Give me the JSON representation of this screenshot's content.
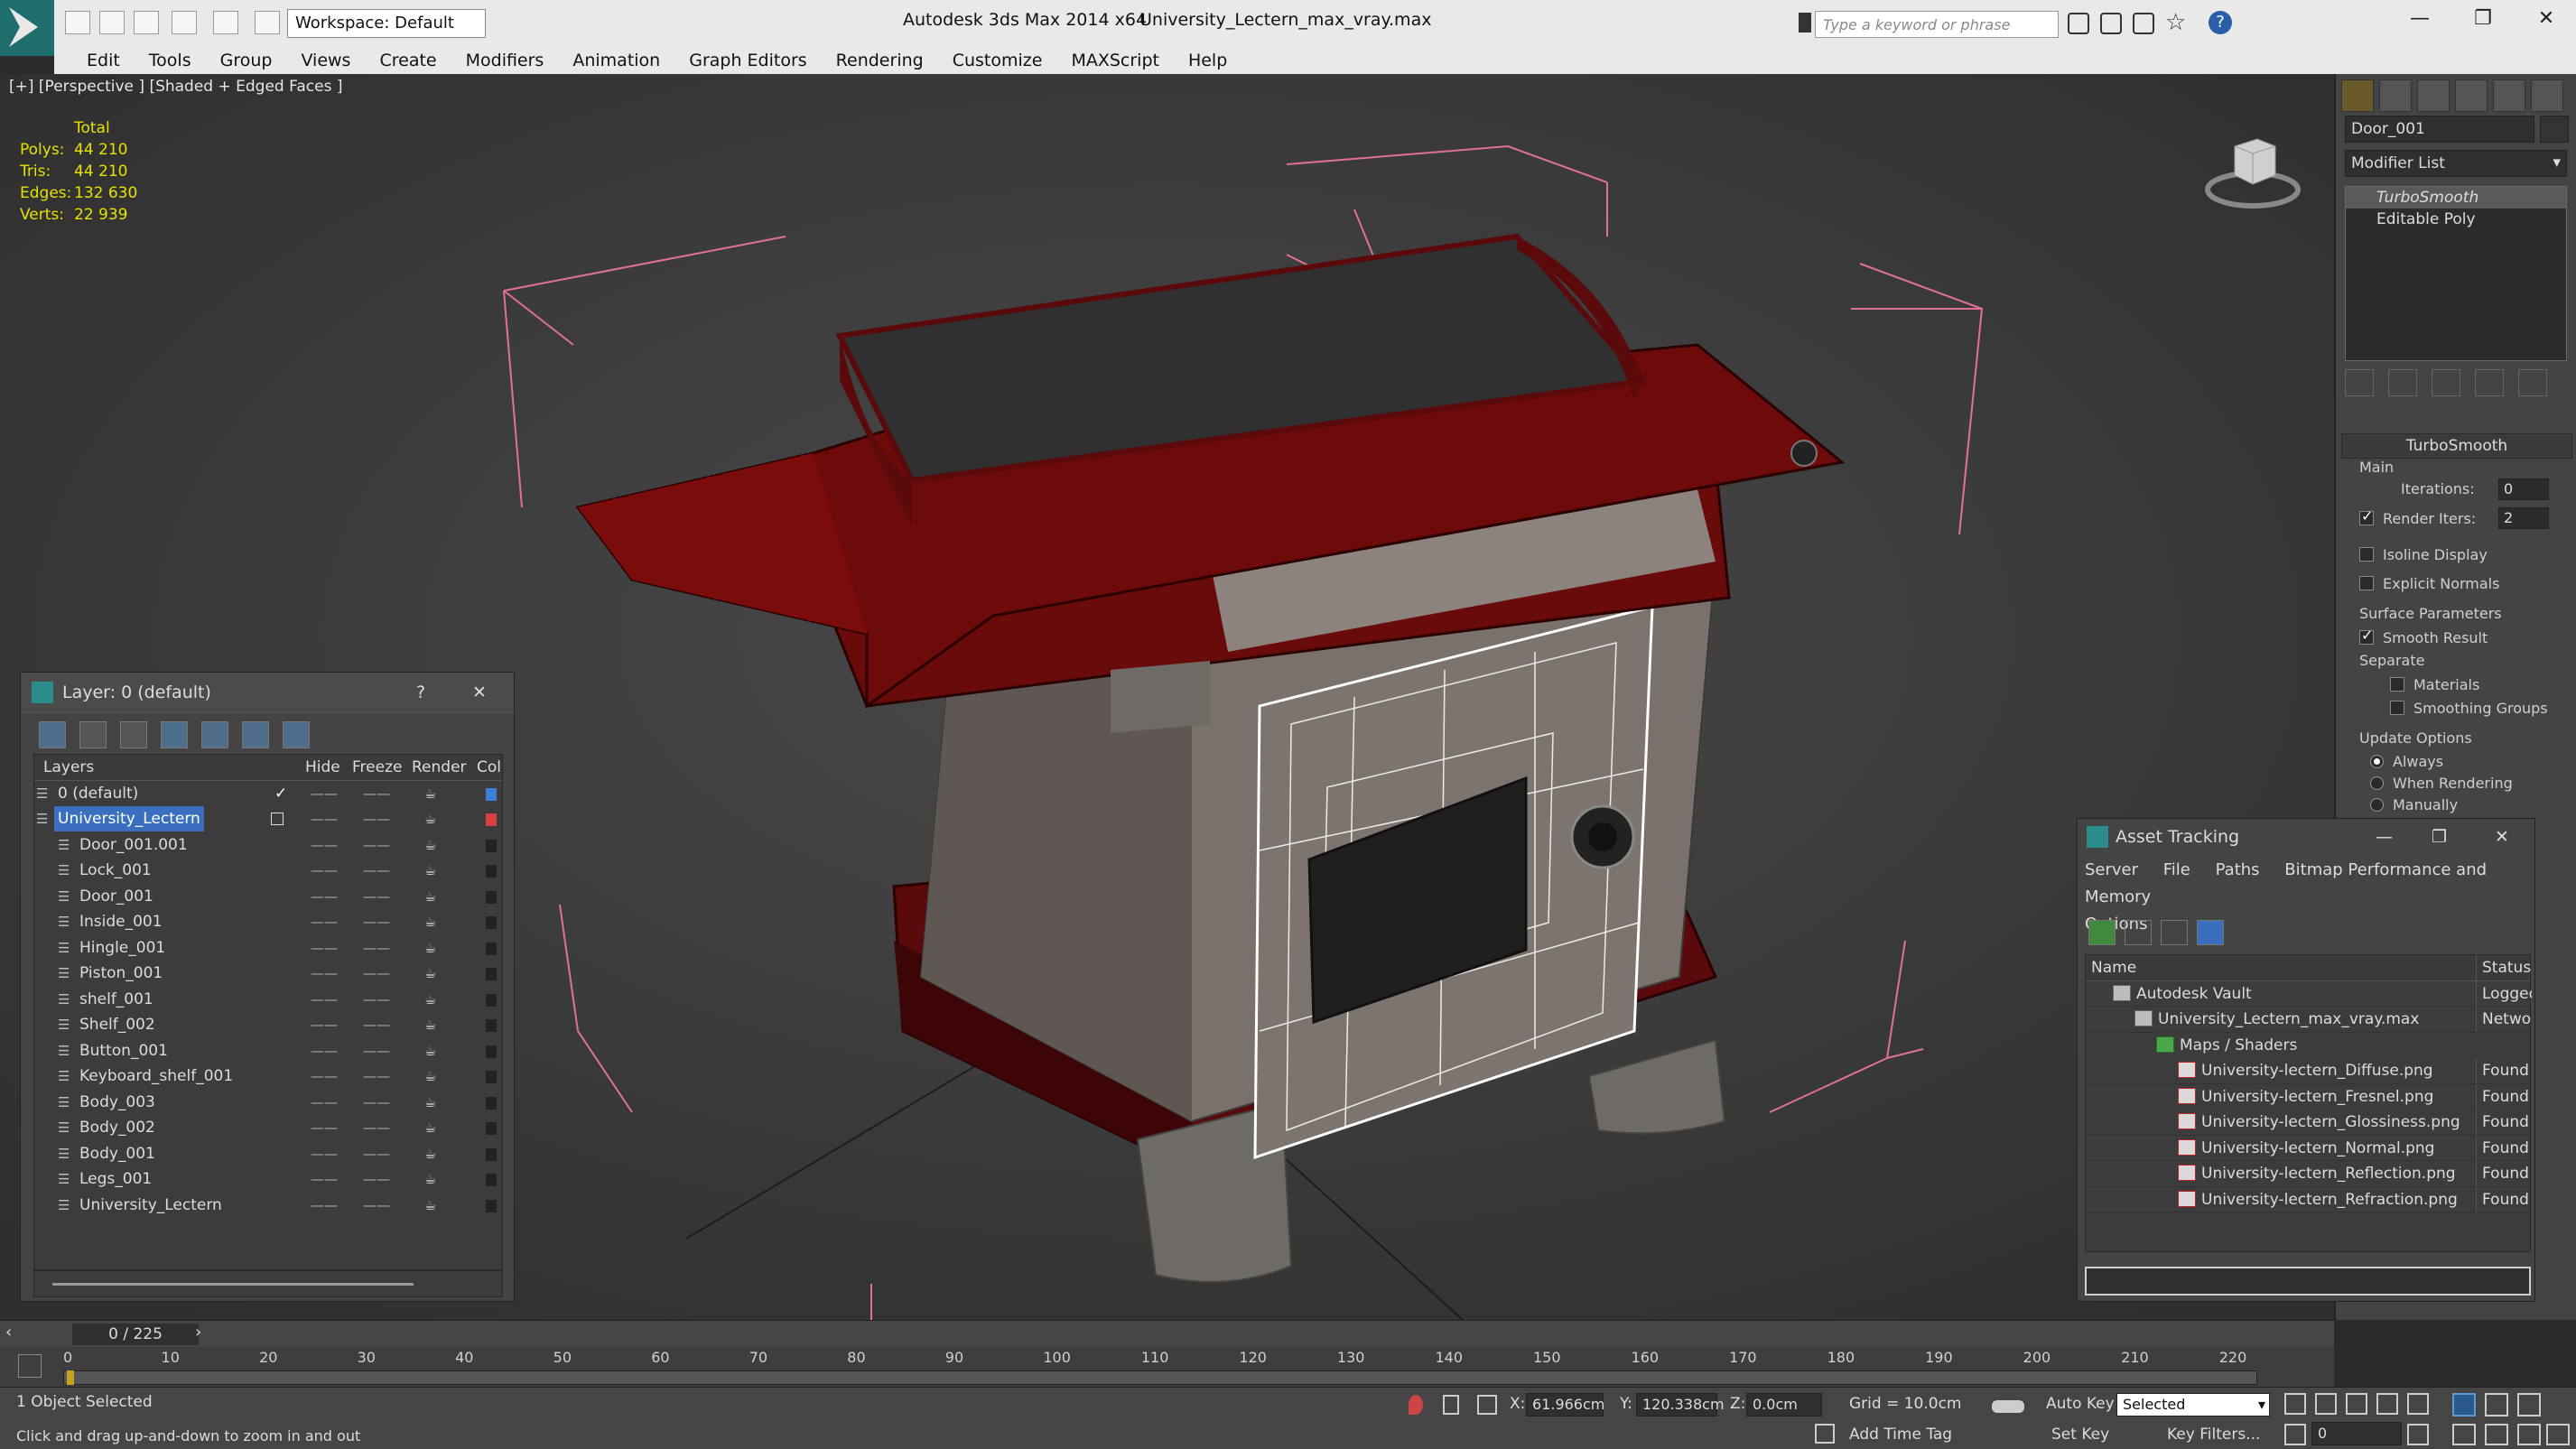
{
  "titlebar": {
    "workspace": "Workspace: Default",
    "app_title": "Autodesk 3ds Max  2014 x64",
    "file_title": "University_Lectern_max_vray.max",
    "search_placeholder": "Type a keyword or phrase",
    "controls": [
      "—",
      "❐",
      "✕"
    ]
  },
  "menu": [
    "Edit",
    "Tools",
    "Group",
    "Views",
    "Create",
    "Modifiers",
    "Animation",
    "Graph Editors",
    "Rendering",
    "Customize",
    "MAXScript",
    "Help"
  ],
  "viewport": {
    "label": "[+] [Perspective ] [Shaded + Edged Faces ]",
    "stats_header": "Total",
    "stats": [
      {
        "label": "Polys:",
        "value": "44 210"
      },
      {
        "label": "Tris:",
        "value": "44 210"
      },
      {
        "label": "Edges:",
        "value": "132 630"
      },
      {
        "label": "Verts:",
        "value": "22 939"
      }
    ],
    "stats_color": "#e8e000"
  },
  "command_panel": {
    "object_name": "Door_001",
    "modifier_list": "Modifier List",
    "stack": [
      "TurboSmooth",
      "Editable Poly"
    ],
    "rollout_title": "TurboSmooth",
    "main_label": "Main",
    "iterations_label": "Iterations:",
    "iterations_value": "0",
    "render_iters_label": "Render Iters:",
    "render_iters_value": "2",
    "isoline_label": "Isoline Display",
    "explicit_normals_label": "Explicit Normals",
    "surface_params_label": "Surface Parameters",
    "smooth_result_label": "Smooth Result",
    "separate_label": "Separate",
    "materials_label": "Materials",
    "smoothing_groups_label": "Smoothing Groups",
    "update_options_label": "Update Options",
    "update_always": "Always",
    "update_when_rendering": "When Rendering",
    "update_manually": "Manually"
  },
  "layer_dialog": {
    "title": "Layer: 0 (default)",
    "help": "?",
    "close": "✕",
    "columns": [
      "Layers",
      "Hide",
      "Freeze",
      "Render",
      "Col"
    ],
    "rows": [
      {
        "name": "0 (default)",
        "indent": 0,
        "color": "#3b7fd9",
        "checked": true
      },
      {
        "name": "University_Lectern",
        "indent": 0,
        "color": "#d94040",
        "selected": true
      },
      {
        "name": "Door_001.001",
        "indent": 1,
        "color": "#222222"
      },
      {
        "name": "Lock_001",
        "indent": 1,
        "color": "#222222"
      },
      {
        "name": "Door_001",
        "indent": 1,
        "color": "#222222"
      },
      {
        "name": "Inside_001",
        "indent": 1,
        "color": "#222222"
      },
      {
        "name": "Hingle_001",
        "indent": 1,
        "color": "#222222"
      },
      {
        "name": "Piston_001",
        "indent": 1,
        "color": "#222222"
      },
      {
        "name": "shelf_001",
        "indent": 1,
        "color": "#222222"
      },
      {
        "name": "Shelf_002",
        "indent": 1,
        "color": "#222222"
      },
      {
        "name": "Button_001",
        "indent": 1,
        "color": "#222222"
      },
      {
        "name": "Keyboard_shelf_001",
        "indent": 1,
        "color": "#222222"
      },
      {
        "name": "Body_003",
        "indent": 1,
        "color": "#222222"
      },
      {
        "name": "Body_002",
        "indent": 1,
        "color": "#222222"
      },
      {
        "name": "Body_001",
        "indent": 1,
        "color": "#222222"
      },
      {
        "name": "Legs_001",
        "indent": 1,
        "color": "#222222"
      },
      {
        "name": "University_Lectern",
        "indent": 1,
        "color": "#222222"
      }
    ]
  },
  "asset_dialog": {
    "title": "Asset Tracking",
    "menu": [
      "Server",
      "File",
      "Paths",
      "Bitmap Performance and Memory",
      "Options"
    ],
    "columns": [
      "Name",
      "Status"
    ],
    "rows": [
      {
        "name": "Autodesk Vault",
        "status": "Logged Out",
        "indent": 1
      },
      {
        "name": "University_Lectern_max_vray.max",
        "status": "Network Path",
        "indent": 2
      },
      {
        "name": "Maps / Shaders",
        "status": "",
        "indent": 3
      },
      {
        "name": "University-lectern_Diffuse.png",
        "status": "Found",
        "indent": 4
      },
      {
        "name": "University-lectern_Fresnel.png",
        "status": "Found",
        "indent": 4
      },
      {
        "name": "University-lectern_Glossiness.png",
        "status": "Found",
        "indent": 4
      },
      {
        "name": "University-lectern_Normal.png",
        "status": "Found",
        "indent": 4
      },
      {
        "name": "University-lectern_Reflection.png",
        "status": "Found",
        "indent": 4
      },
      {
        "name": "University-lectern_Refraction.png",
        "status": "Found",
        "indent": 4
      }
    ]
  },
  "timeline": {
    "frame_label": "0 / 225",
    "ticks": [
      "0",
      "10",
      "20",
      "30",
      "40",
      "50",
      "60",
      "70",
      "80",
      "90",
      "100",
      "110",
      "120",
      "130",
      "140",
      "150",
      "160",
      "170",
      "180",
      "190",
      "200",
      "210",
      "220"
    ]
  },
  "statusbar": {
    "selection": "1 Object Selected",
    "prompt": "Click and drag up-and-down to zoom in and out",
    "x_label": "X:",
    "x_value": "61.966cm",
    "y_label": "Y:",
    "y_value": "120.338cm",
    "z_label": "Z:",
    "z_value": "0.0cm",
    "grid": "Grid = 10.0cm",
    "auto_key": "Auto Key",
    "selected_dropdown": "Selected",
    "set_key": "Set Key",
    "key_filters": "Key Filters...",
    "add_time_tag": "Add Time Tag",
    "frame_value": "0"
  }
}
